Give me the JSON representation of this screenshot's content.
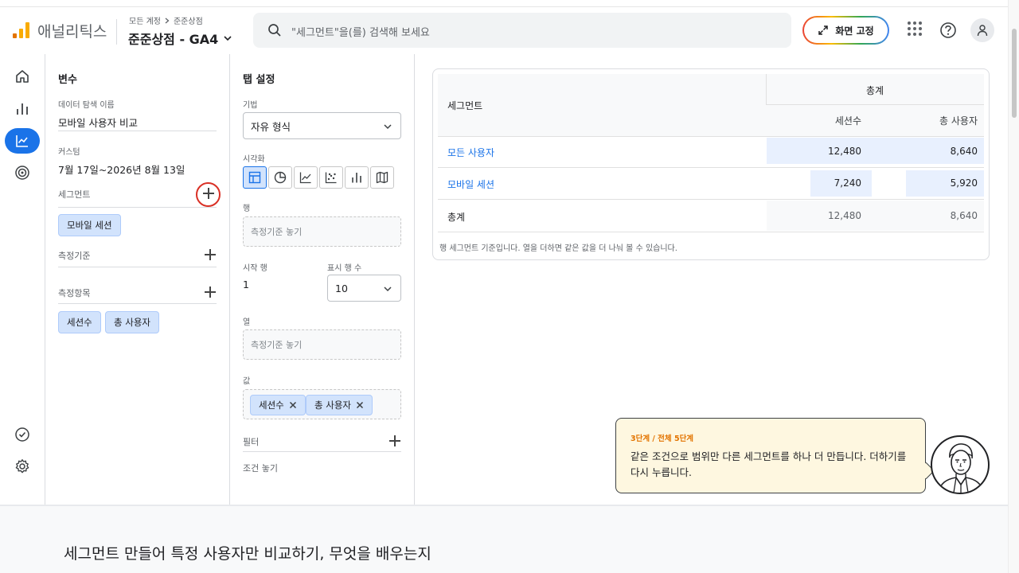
{
  "header": {
    "brand": "애널리틱스",
    "breadcrumb": [
      "모든 계정",
      "준준상점"
    ],
    "account": "준준상점 - GA4",
    "search_placeholder": "\"세그먼트\"을(를) 검색해 보세요",
    "pin_label": "화면 고정"
  },
  "rail": {
    "items": [
      "home-icon",
      "reports-icon",
      "explore-icon",
      "advertising-icon",
      "check-icon",
      "settings-icon"
    ],
    "active": "explore-icon"
  },
  "variables": {
    "title": "변수",
    "name_label": "데이터 탐색 이름",
    "name_value": "모바일 사용자 비교",
    "custom_label": "커스텀",
    "date_range": "7월 17일~2026년 8월 13일",
    "segments_label": "세그먼트",
    "segment_chips": [
      "모바일 세션"
    ],
    "dimensions_label": "측정기준",
    "metrics_label": "측정항목",
    "metric_chips": [
      "세션수",
      "총 사용자"
    ]
  },
  "tab_settings": {
    "title": "탭 설정",
    "technique_label": "기법",
    "technique_value": "자유 형식",
    "viz_label": "시각화",
    "viz_options": [
      "table-icon",
      "donut-icon",
      "line-icon",
      "scatter-icon",
      "bar-icon",
      "map-icon"
    ],
    "rows_label": "행",
    "rows_drop": "측정기준 놓기",
    "start_row_label": "시작 행",
    "start_row_value": "1",
    "show_rows_label": "표시 행 수",
    "show_rows_value": "10",
    "columns_label": "열",
    "columns_drop": "측정기준 놓기",
    "values_label": "값",
    "value_chips": [
      "세션수",
      "총 사용자"
    ],
    "filter_label": "필터",
    "filter_drop": "조건 놓기"
  },
  "table": {
    "segment_header": "세그먼트",
    "group_header": "총계",
    "columns": [
      "세션수",
      "총 사용자"
    ],
    "rows": [
      {
        "name": "모든 사용자",
        "values": [
          "12,480",
          "8,640"
        ]
      },
      {
        "name": "모바일 세션",
        "values": [
          "7,240",
          "5,920"
        ]
      },
      {
        "name": "총계",
        "values": [
          "12,480",
          "8,640"
        ]
      }
    ],
    "note": "행 세그먼트 기준입니다. 열을 더하면 같은 값을 더 나눠 볼 수 있습니다."
  },
  "tooltip": {
    "step": "3단계 / 전체 5단계",
    "message": "같은 조건으로 범위만 다른 세그먼트를 하나 더 만듭니다. 더하기를 다시 누릅니다."
  },
  "bottom": {
    "title": "세그먼트 만들어 특정 사용자만 비교하기, 무엇을 배우는지"
  },
  "colors": {
    "accent": "#1a73e8",
    "chip_bg": "#d2e3fc",
    "highlight_ring": "#d93025",
    "tooltip_bg": "#fef7e0",
    "step_orange": "#e37400"
  }
}
